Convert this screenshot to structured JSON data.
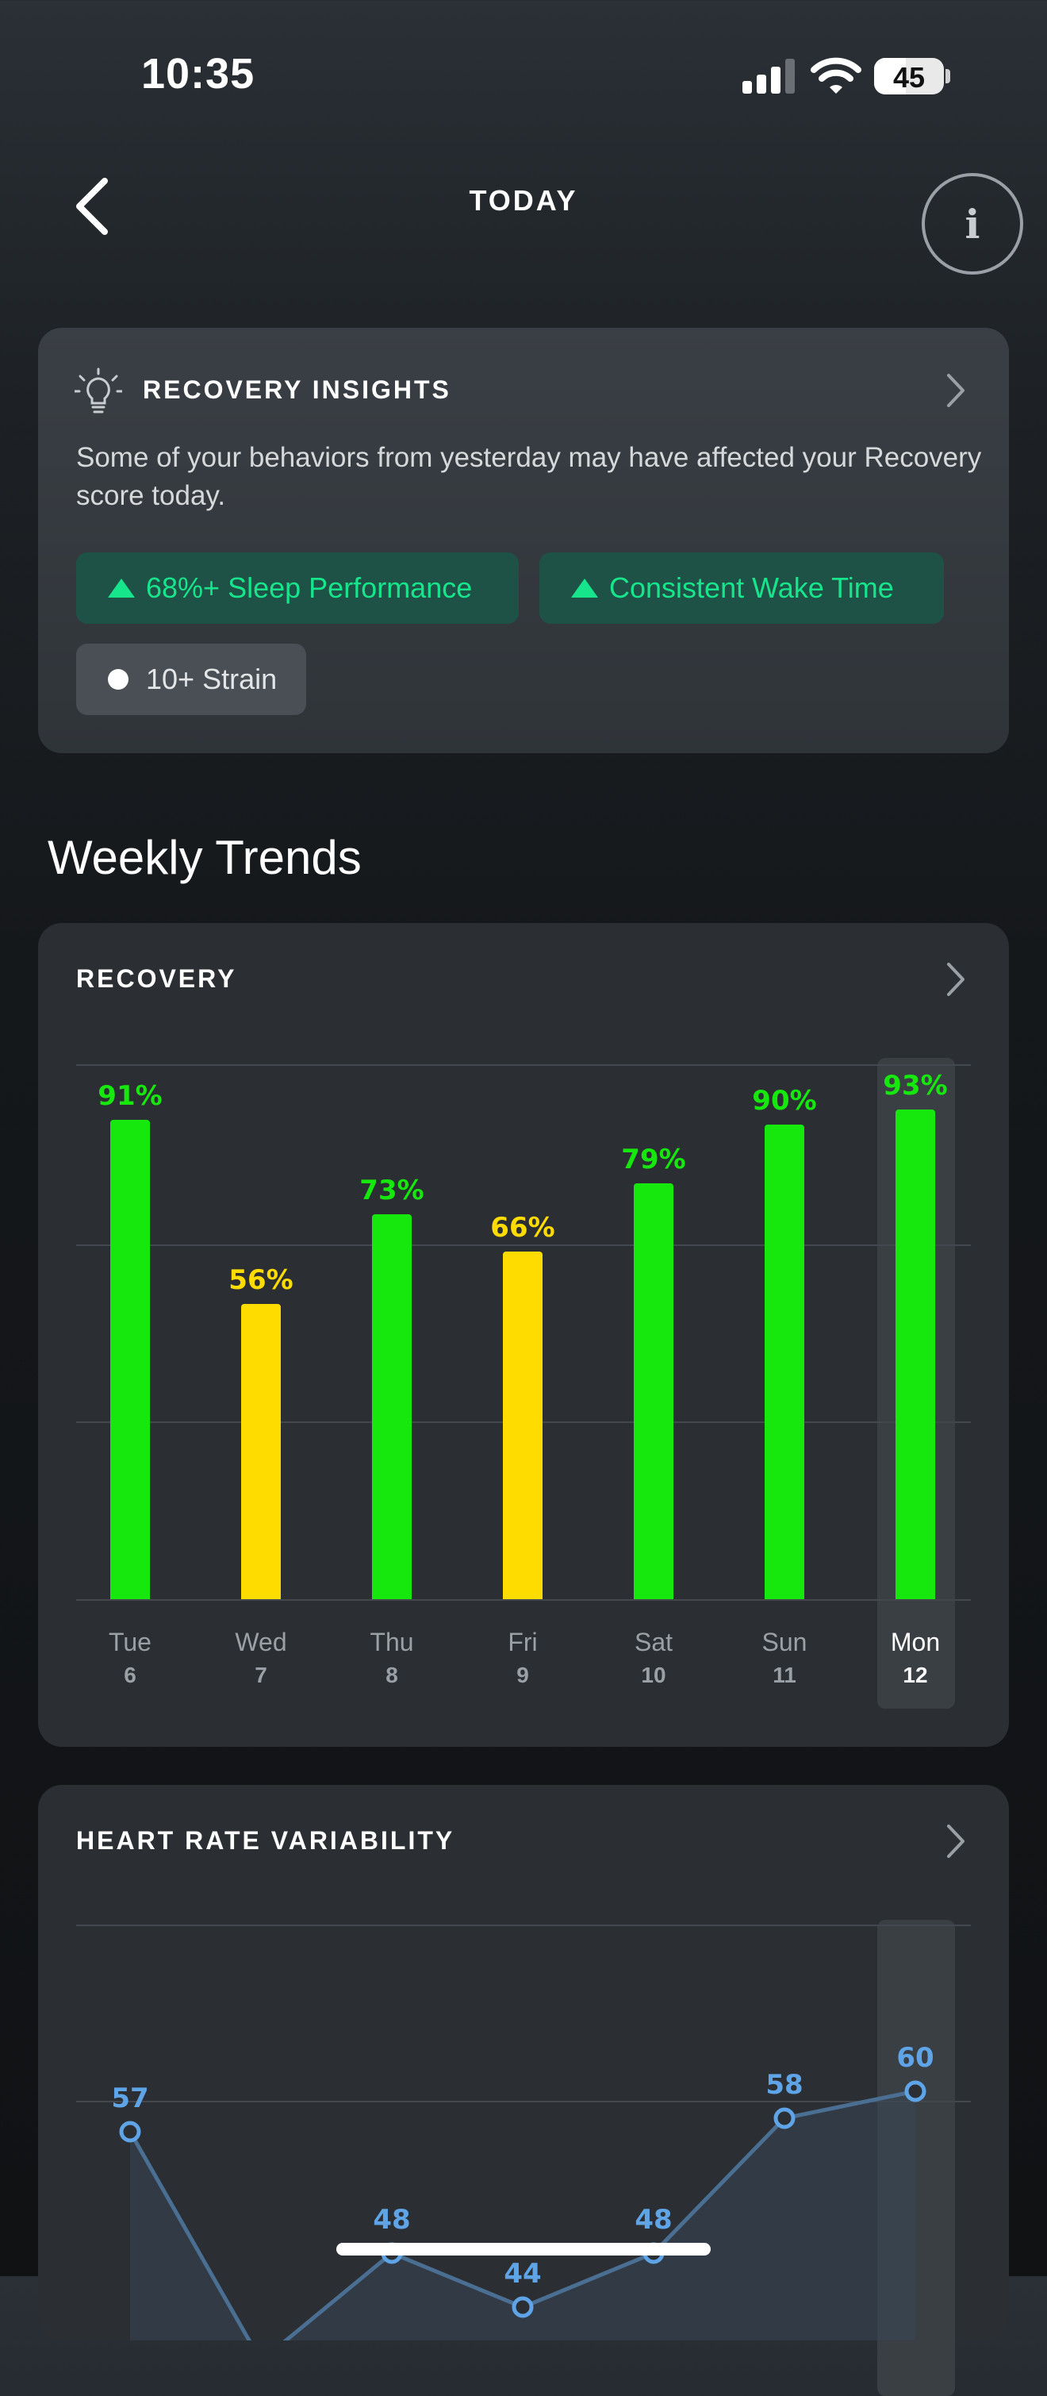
{
  "status_bar": {
    "time": "10:35",
    "battery": "45",
    "battery_level": 0.45
  },
  "nav": {
    "title": "TODAY",
    "back_icon": "chevron-left-icon",
    "info_icon": "info-icon",
    "info_glyph": "i"
  },
  "insights": {
    "title": "RECOVERY INSIGHTS",
    "description": "Some of your behaviors from yesterday may have affected your Recovery score today.",
    "chips": [
      {
        "label": "68%+ Sleep Performance",
        "kind": "positive"
      },
      {
        "label": "Consistent Wake Time",
        "kind": "positive"
      },
      {
        "label": "10+ Strain",
        "kind": "neutral"
      }
    ],
    "colors": {
      "positive": "#17e58b",
      "positive_bg": "#1f5247"
    }
  },
  "weekly": {
    "title": "Weekly Trends"
  },
  "recovery_card": {
    "title": "RECOVERY"
  },
  "hrv_card": {
    "title": "HEART RATE VARIABILITY"
  },
  "days": [
    {
      "name": "Tue",
      "num": "6"
    },
    {
      "name": "Wed",
      "num": "7"
    },
    {
      "name": "Thu",
      "num": "8"
    },
    {
      "name": "Fri",
      "num": "9"
    },
    {
      "name": "Sat",
      "num": "10"
    },
    {
      "name": "Sun",
      "num": "11"
    },
    {
      "name": "Mon",
      "num": "12"
    }
  ],
  "chart_data": [
    {
      "type": "bar",
      "title": "RECOVERY",
      "categories": [
        "Tue 6",
        "Wed 7",
        "Thu 8",
        "Fri 9",
        "Sat 10",
        "Sun 11",
        "Mon 12"
      ],
      "values": [
        91,
        56,
        73,
        66,
        79,
        90,
        93
      ],
      "labels": [
        "91%",
        "56%",
        "73%",
        "66%",
        "79%",
        "90%",
        "93%"
      ],
      "ylim": [
        0,
        100
      ],
      "grid": true,
      "selected_index": 6,
      "colors": {
        "green": "#16e80e",
        "yellow": "#ffdc00"
      }
    },
    {
      "type": "line",
      "title": "HEART RATE VARIABILITY",
      "categories": [
        "Tue 6",
        "Wed 7",
        "Thu 8",
        "Fri 9",
        "Sat 10",
        "Sun 11",
        "Mon 12"
      ],
      "values": [
        57,
        40,
        48,
        44,
        48,
        58,
        60
      ],
      "labels": [
        "57",
        "",
        "48",
        "44",
        "48",
        "58",
        "60"
      ],
      "ylim": [
        30,
        70
      ],
      "grid": true,
      "selected_index": 6,
      "colors": {
        "line": "#4a6f93",
        "point": "#5fa4e6"
      }
    }
  ]
}
